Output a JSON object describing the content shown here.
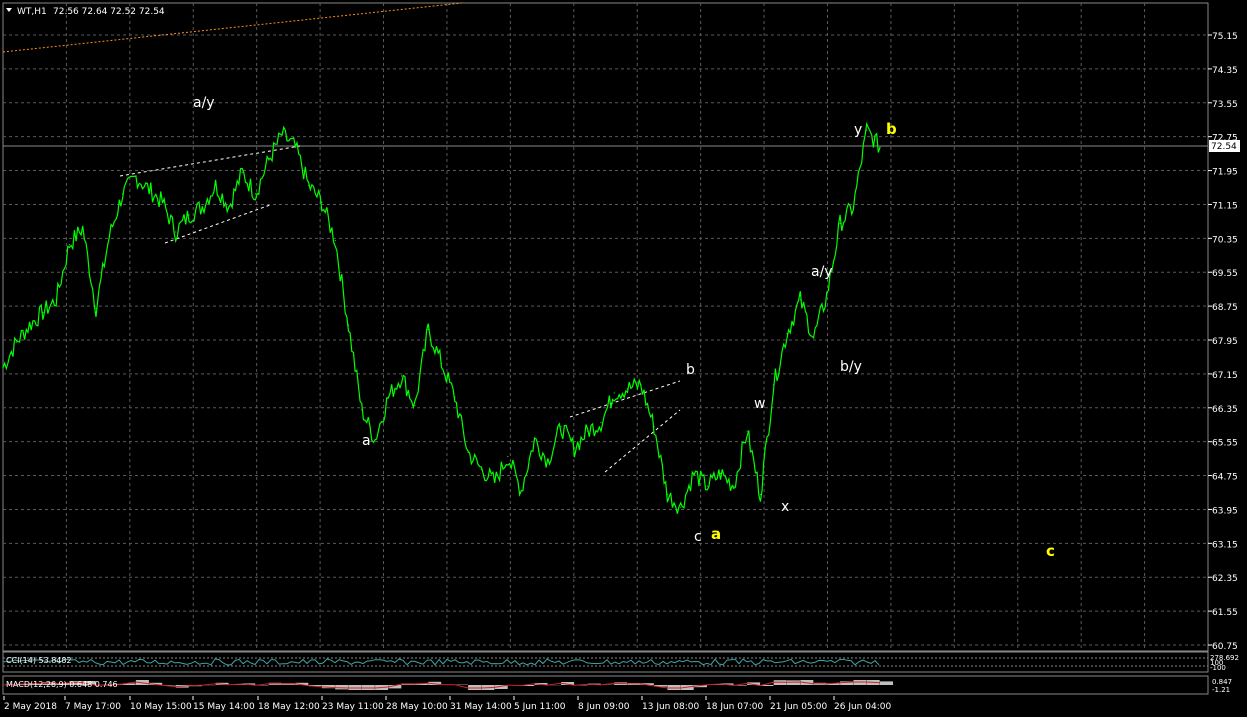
{
  "header": {
    "symbol_label": "WT,H1",
    "ohlc_text": "72.56 72.64 72.52 72.54"
  },
  "price_axis": {
    "ticks": [
      "75.15",
      "74.35",
      "73.55",
      "72.75",
      "71.95",
      "71.15",
      "70.35",
      "69.55",
      "68.75",
      "67.95",
      "67.15",
      "66.35",
      "65.55",
      "64.75",
      "63.95",
      "63.15",
      "62.35",
      "61.55",
      "60.75"
    ],
    "current_price": "72.54"
  },
  "time_axis": {
    "ticks": [
      "2 May 2018",
      "7 May 17:00",
      "10 May 15:00",
      "15 May 14:00",
      "18 May 12:00",
      "23 May 11:00",
      "28 May 10:00",
      "31 May 14:00",
      "5 Jun 11:00",
      "8 Jun 09:00",
      "13 Jun 08:00",
      "18 Jun 07:00",
      "21 Jun 05:00",
      "26 Jun 04:00"
    ]
  },
  "indicators": {
    "cci_label": "CCI(14) 53.8482",
    "cci_scale": [
      "278.692",
      "100",
      "-100",
      "-154.6"
    ],
    "macd_label": "MACD(12,26,9) 0.648 0.746",
    "macd_scale": [
      "0.847",
      "-1.21"
    ]
  },
  "wave_labels": [
    {
      "text": "a/y",
      "color": "#ffffff"
    },
    {
      "text": "a",
      "color": "#ffffff"
    },
    {
      "text": "b",
      "color": "#ffffff"
    },
    {
      "text": "c",
      "color": "#ffffff"
    },
    {
      "text": "a",
      "color": "#ffff00"
    },
    {
      "text": "w",
      "color": "#ffffff"
    },
    {
      "text": "x",
      "color": "#ffffff"
    },
    {
      "text": "a/y",
      "color": "#ffffff"
    },
    {
      "text": "b/y",
      "color": "#ffffff"
    },
    {
      "text": "y",
      "color": "#ffffff"
    },
    {
      "text": "b",
      "color": "#ffff00"
    },
    {
      "text": "c",
      "color": "#ffff00"
    }
  ],
  "colors": {
    "background": "#000000",
    "price_line": "#00ff00",
    "grid": "#5a5a5a",
    "axis_text": "#ffffff",
    "trendline": "#ff8c1a"
  },
  "chart_data": {
    "type": "line",
    "title": "WT,H1",
    "y_range": [
      60.5,
      75.7
    ],
    "x_range": [
      "2 May 2018",
      "26 Jun 04:00"
    ],
    "series": [
      {
        "values": [
          67.3,
          67.9,
          68.3,
          68.6,
          68.9,
          70.2,
          70.6,
          68.7,
          70.4,
          71.4,
          71.8,
          71.5,
          71.2,
          70.5,
          70.9,
          71.1,
          71.6,
          71.1,
          71.9,
          71.4,
          72.2,
          72.8,
          72.5,
          71.6,
          71.2,
          70.3,
          68.3,
          66.3,
          65.6,
          66.6,
          67.1,
          66.4,
          68.2,
          67.4,
          66.6,
          65.3,
          64.9,
          64.6,
          65.2,
          64.4,
          65.6,
          65.1,
          65.9,
          65.4,
          65.8,
          66.0,
          66.7,
          66.8,
          66.9,
          65.9,
          64.3,
          64.0,
          64.8,
          64.5,
          64.8,
          64.5,
          65.8,
          64.3,
          66.9,
          68.1,
          68.9,
          68.0,
          69.0,
          70.7,
          71.1,
          72.9,
          72.5
        ]
      }
    ],
    "price_ticks": [
      75.15,
      74.35,
      73.55,
      72.75,
      71.95,
      71.15,
      70.35,
      69.55,
      68.75,
      67.95,
      67.15,
      66.35,
      65.55,
      64.75,
      63.95,
      63.15,
      62.35,
      61.55,
      60.75
    ],
    "last_price": 72.54,
    "grid": true
  }
}
